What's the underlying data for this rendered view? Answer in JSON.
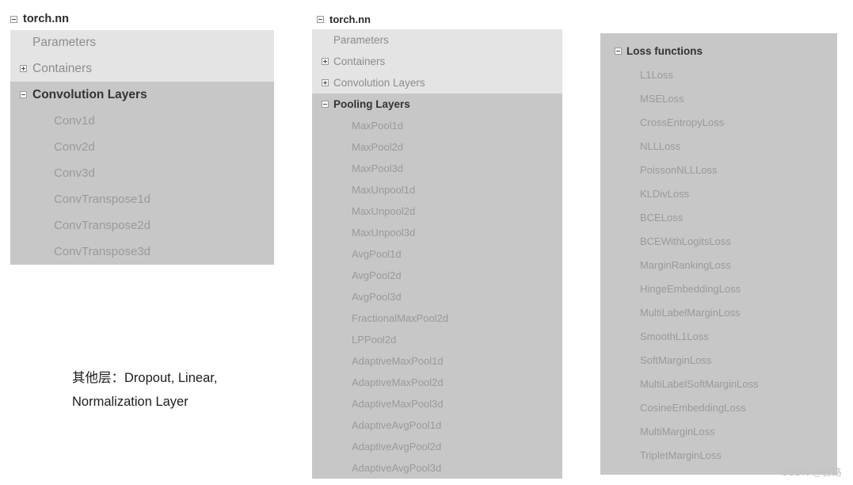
{
  "watermark": "CSDN @古路",
  "note": {
    "line1": "其他层：Dropout, Linear,",
    "line2": "Normalization Layer"
  },
  "colors": {
    "band_light": "#e4e4e4",
    "band_dark": "#c7c7c7",
    "group_text": "#333333",
    "leaf_text": "#9a9a9a",
    "dim_text": "#8c8c8c",
    "page_background": "#ffffff"
  },
  "panels": [
    {
      "id": "panel-conv",
      "header": {
        "label": "torch.nn",
        "icon": "minus-square-icon",
        "state": "expanded"
      },
      "light_rows": [
        {
          "label": "Parameters",
          "icon": "none",
          "kind": "group-dim",
          "state": "leaf"
        },
        {
          "label": "Containers",
          "icon": "plus-square-icon",
          "kind": "group-dim",
          "state": "collapsed"
        }
      ],
      "dark_group": {
        "label": "Convolution Layers",
        "icon": "minus-square-icon",
        "state": "expanded"
      },
      "children": [
        "Conv1d",
        "Conv2d",
        "Conv3d",
        "ConvTranspose1d",
        "ConvTranspose2d",
        "ConvTranspose3d"
      ]
    },
    {
      "id": "panel-pool",
      "header": {
        "label": "torch.nn",
        "icon": "minus-square-icon",
        "state": "expanded"
      },
      "light_rows": [
        {
          "label": "Parameters",
          "icon": "none",
          "kind": "group-dim",
          "state": "leaf"
        },
        {
          "label": "Containers",
          "icon": "plus-square-icon",
          "kind": "group-dim",
          "state": "collapsed"
        },
        {
          "label": "Convolution Layers",
          "icon": "plus-square-icon",
          "kind": "group-dim",
          "state": "collapsed"
        }
      ],
      "dark_group": {
        "label": "Pooling Layers",
        "icon": "minus-square-icon",
        "state": "expanded"
      },
      "children": [
        "MaxPool1d",
        "MaxPool2d",
        "MaxPool3d",
        "MaxUnpool1d",
        "MaxUnpool2d",
        "MaxUnpool3d",
        "AvgPool1d",
        "AvgPool2d",
        "AvgPool3d",
        "FractionalMaxPool2d",
        "LPPool2d",
        "AdaptiveMaxPool1d",
        "AdaptiveMaxPool2d",
        "AdaptiveMaxPool3d",
        "AdaptiveAvgPool1d",
        "AdaptiveAvgPool2d",
        "AdaptiveAvgPool3d"
      ]
    },
    {
      "id": "panel-loss",
      "dark_group": {
        "label": "Loss functions",
        "icon": "minus-square-icon",
        "state": "expanded"
      },
      "children": [
        "L1Loss",
        "MSELoss",
        "CrossEntropyLoss",
        "NLLLoss",
        "PoissonNLLLoss",
        "KLDivLoss",
        "BCELoss",
        "BCEWithLogitsLoss",
        "MarginRankingLoss",
        "HingeEmbeddingLoss",
        "MultiLabelMarginLoss",
        "SmoothL1Loss",
        "SoftMarginLoss",
        "MultiLabelSoftMarginLoss",
        "CosineEmbeddingLoss",
        "MultiMarginLoss",
        "TripletMarginLoss"
      ]
    }
  ]
}
